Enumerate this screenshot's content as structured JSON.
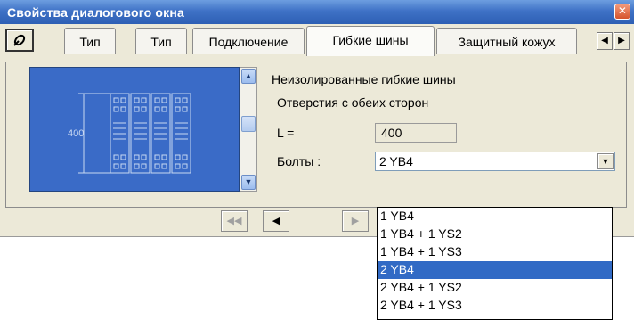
{
  "window": {
    "title": "Свойства диалогового окна",
    "close_glyph": "✕",
    "title_color": "#3f72c6"
  },
  "tabs": {
    "scroll_left": "◀",
    "scroll_right": "▶",
    "items": [
      {
        "label": "Тип"
      },
      {
        "label": "Тип"
      },
      {
        "label": "Подключение"
      },
      {
        "label": "Гибкие шины",
        "active": true
      },
      {
        "label": "Защитный кожух"
      }
    ]
  },
  "preview": {
    "dimension_label": "400",
    "background_color": "#3a6bc7",
    "scroll_up": "▲",
    "scroll_down": "▼"
  },
  "properties": {
    "heading": "Неизолированные гибкие шины",
    "subheading": "Отверстия с обеих сторон",
    "length_label": "L =",
    "length_value": "400",
    "bolts_label": "Болты :",
    "bolts_value": "2 YB4",
    "combo_arrow": "▼"
  },
  "nav": {
    "first": "◀◀",
    "prev": "◀",
    "next": "▶"
  },
  "dropdown": {
    "options": [
      "1 YB4",
      "1 YB4 + 1 YS2",
      "1 YB4 + 1 YS3",
      "2 YB4",
      "2 YB4 + 1 YS2",
      "2 YB4 + 1 YS3"
    ],
    "selected": "2 YB4",
    "highlight_color": "#316ac5"
  }
}
